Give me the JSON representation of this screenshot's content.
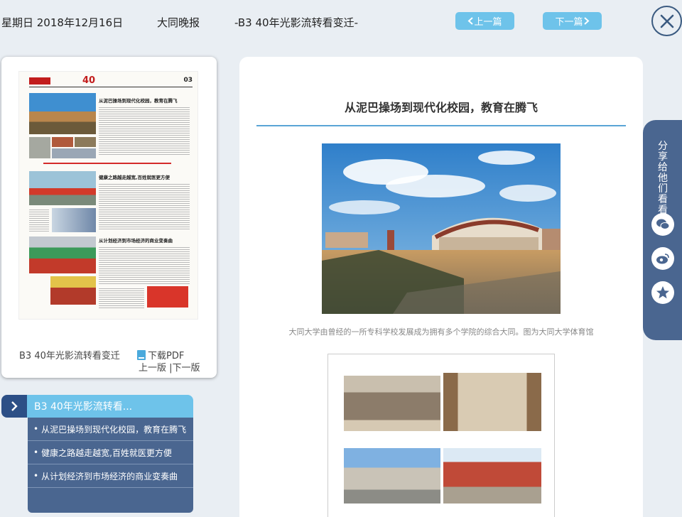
{
  "header": {
    "date": "星期日 2018年12月16日",
    "paper": "大同晚报",
    "page_name": "-B3 40年光影流转看变迁-",
    "prev_label": "上一篇",
    "next_label": "下一篇"
  },
  "thumbnail": {
    "label": "B3 40年光影流转看变迁",
    "pdf_label": "下载PDF",
    "edition_nav": "上一版 |下一版",
    "newspaper": {
      "page_number": "03",
      "anniv": "40",
      "headline_1": "从泥巴操场到现代化校园，教育在腾飞",
      "headline_2": "健康之路越走越宽,百姓就医更方便",
      "headline_3": "从计划经济到市场经济的商业变奏曲"
    }
  },
  "section": {
    "title": "B3  40年光影流转看...",
    "items": [
      {
        "label": "从泥巴操场到现代化校园，教育在腾飞"
      },
      {
        "label": "健康之路越走越宽,百姓就医更方便"
      },
      {
        "label": "从计划经济到市场经济的商业变奏曲"
      }
    ]
  },
  "article": {
    "title": "从泥巴操场到现代化校园，教育在腾飞",
    "caption": "大同大学由曾经的一所专科学校发展成为拥有多个学院的综合大同。图为大同大学体育馆"
  },
  "share": {
    "label": "分享给他们看看",
    "icons": [
      "wechat-icon",
      "weibo-icon",
      "qzone-icon"
    ]
  },
  "colors": {
    "accent": "#6ec3ea",
    "navy": "#4a6690",
    "dark_navy": "#2c4f86",
    "background": "#e9eef3"
  }
}
